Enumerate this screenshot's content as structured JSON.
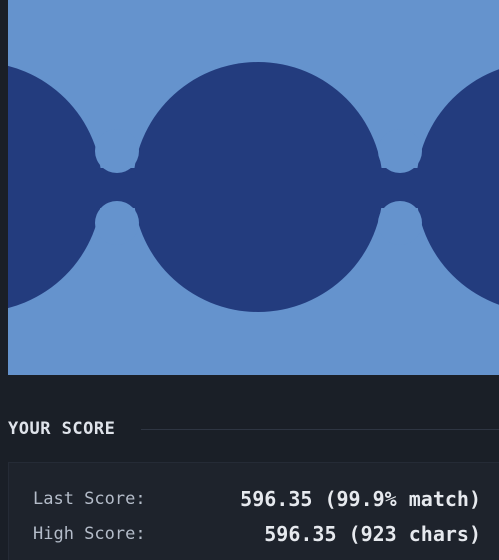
{
  "colors": {
    "preview_background": "#6593cd",
    "shape_fill": "#233c7e",
    "page_background": "#1a1f27"
  },
  "score_section": {
    "title": "YOUR SCORE",
    "last_score": {
      "label": "Last Score:",
      "value": "596.35 (99.9% match)"
    },
    "high_score": {
      "label": "High Score:",
      "value": "596.35 (923 chars)"
    }
  }
}
